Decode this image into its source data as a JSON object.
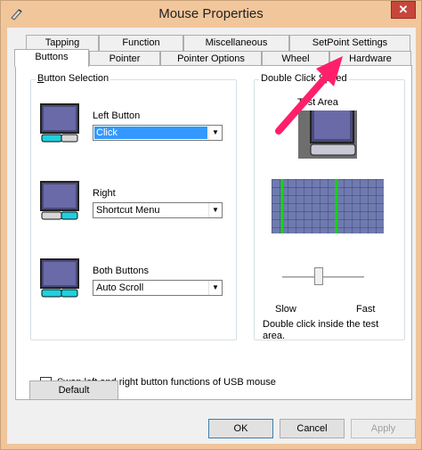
{
  "window": {
    "title": "Mouse Properties",
    "close_label": "✕",
    "app_icon": "mouse-app-icon"
  },
  "tabs": {
    "row1": [
      "Tapping",
      "Function",
      "Miscellaneous",
      "SetPoint Settings"
    ],
    "row2": [
      "Buttons",
      "Pointer",
      "Pointer Options",
      "Wheel",
      "Hardware"
    ],
    "active": "Buttons"
  },
  "button_selection": {
    "group_label": "Button Selection",
    "left_label": "Left Button",
    "left_value": "Click",
    "right_label": "Right",
    "right_value": "Shortcut Menu",
    "both_label": "Both Buttons",
    "both_value": "Auto Scroll"
  },
  "double_click": {
    "group_label": "Double Click Speed",
    "test_area_label": "Test Area",
    "slow_label": "Slow",
    "fast_label": "Fast",
    "speed_level": 0.45,
    "hint": "Double click inside the test area."
  },
  "swap_checkbox": {
    "label": "Swap left and right button functions of USB mouse",
    "checked": false
  },
  "buttons": {
    "default_label": "Default",
    "ok_label": "OK",
    "cancel_label": "Cancel",
    "apply_label": "Apply"
  },
  "colors": {
    "title_bar": "#f2c69b",
    "close_button": "#c7463c",
    "selection": "#3399ff",
    "annotation_arrow": "#ff1f6b"
  }
}
